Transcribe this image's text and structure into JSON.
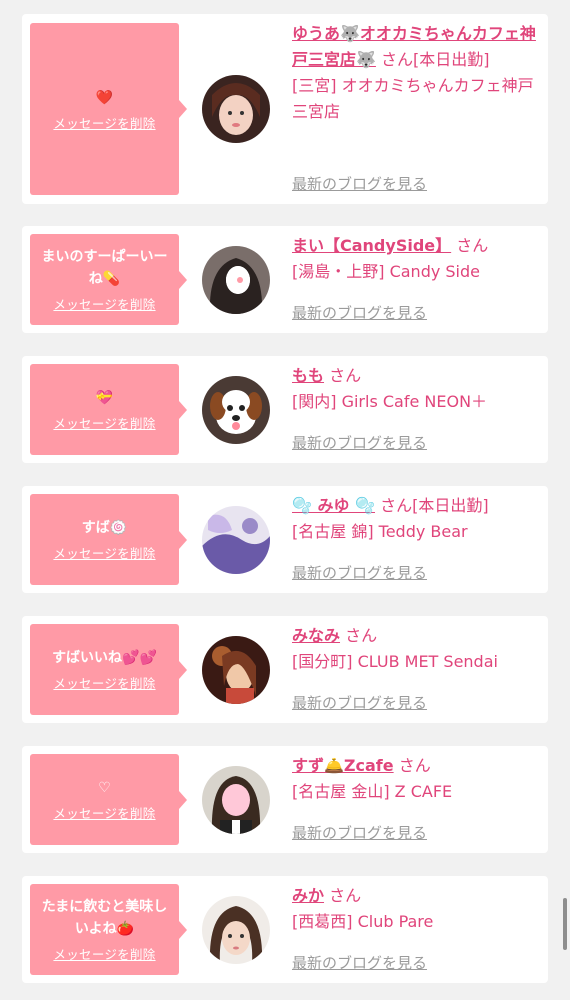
{
  "entries": [
    {
      "message": "❤️",
      "delete_label": "メッセージを削除",
      "name": "ゆうあ🐺オオカミちゃんカフェ神戸三宮店🐺",
      "honorific": "さん",
      "status": "[本日出勤]",
      "area": "[三宮] オオカミちゃんカフェ神戸三宮店",
      "blog_label": "最新のブログを見る"
    },
    {
      "message": "まいのすーぱーいーね💊",
      "delete_label": "メッセージを削除",
      "name": "まい【CandySide】",
      "honorific": "さん",
      "status": "",
      "area": "[湯島・上野] Candy Side",
      "blog_label": "最新のブログを見る"
    },
    {
      "message": "💝",
      "delete_label": "メッセージを削除",
      "name": "もも",
      "honorific": "さん",
      "status": "",
      "area": "[関内] Girls Cafe NEON＋",
      "blog_label": "最新のブログを見る"
    },
    {
      "message": "すば🍥",
      "delete_label": "メッセージを削除",
      "name": "🫧 みゆ 🫧",
      "honorific": "さん",
      "status": "[本日出勤]",
      "area": "[名古屋 錦] Teddy Bear",
      "blog_label": "最新のブログを見る"
    },
    {
      "message": "すばいいね💕💕",
      "delete_label": "メッセージを削除",
      "name": "みなみ",
      "honorific": "さん",
      "status": "",
      "area": "[国分町] CLUB MET Sendai",
      "blog_label": "最新のブログを見る"
    },
    {
      "message": "♡",
      "delete_label": "メッセージを削除",
      "name": "すず🛎️Zcafe",
      "honorific": "さん",
      "status": "",
      "area": "[名古屋 金山] Z CAFE",
      "blog_label": "最新のブログを見る"
    },
    {
      "message": "たまに飲むと美味しいよね🍅",
      "delete_label": "メッセージを削除",
      "name": "みか",
      "honorific": "さん",
      "status": "",
      "area": "[西葛西] Club Pare",
      "blog_label": "最新のブログを見る"
    }
  ],
  "colors": {
    "bubble": "#ff9aa6",
    "name": "#e0457b",
    "link_gray": "#9b9b9b",
    "background": "#f1f1f1"
  }
}
